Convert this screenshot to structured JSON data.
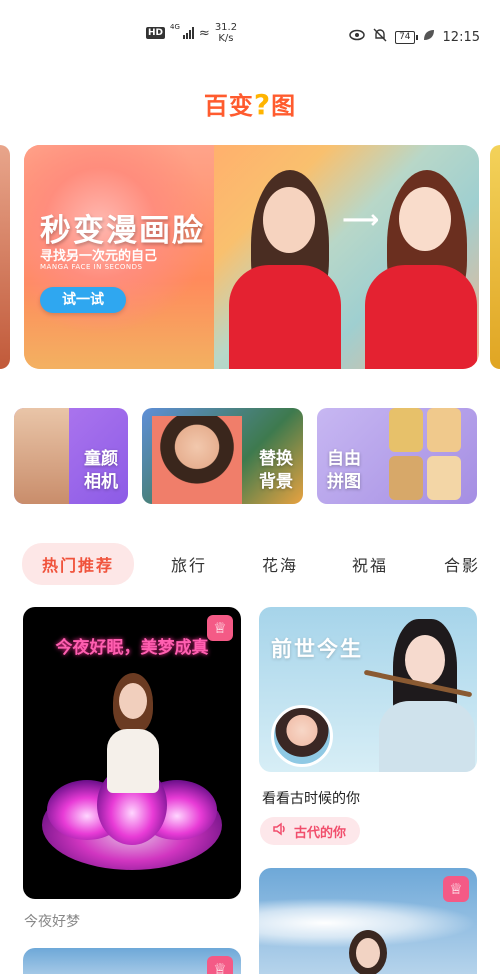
{
  "status_bar": {
    "hd": "HD",
    "network": "4G",
    "speed_value": "31.2",
    "speed_unit": "K/s",
    "battery": "74",
    "time": "12:15"
  },
  "app": {
    "logo_text_left": "百变",
    "logo_text_q": "?",
    "logo_text_right": "图"
  },
  "banner": {
    "title": "秒变漫画脸",
    "subtitle": "寻找另一次元的自己",
    "subtitle_en": "MANGA FACE IN SECONDS",
    "button_label": "试一试"
  },
  "features": [
    {
      "line1": "童颜",
      "line2": "相机"
    },
    {
      "line1": "替换",
      "line2": "背景"
    },
    {
      "line1": "自由",
      "line2": "拼图"
    }
  ],
  "tabs": [
    {
      "label": "热门推荐",
      "active": true
    },
    {
      "label": "旅行",
      "active": false
    },
    {
      "label": "花海",
      "active": false
    },
    {
      "label": "祝福",
      "active": false
    },
    {
      "label": "合影",
      "active": false
    }
  ],
  "cards": {
    "a": {
      "title": "今夜好眠，美梦成真",
      "caption": "今夜好梦"
    },
    "b": {
      "title": "前世今生",
      "caption": "看看古时候的你",
      "tag": "古代的你"
    },
    "badge_icon": "crown-icon"
  },
  "colors": {
    "accent": "#f0533c",
    "brand": "#ff5b2e",
    "try_button": "#2fa7f0",
    "badge": "#f45a86"
  }
}
